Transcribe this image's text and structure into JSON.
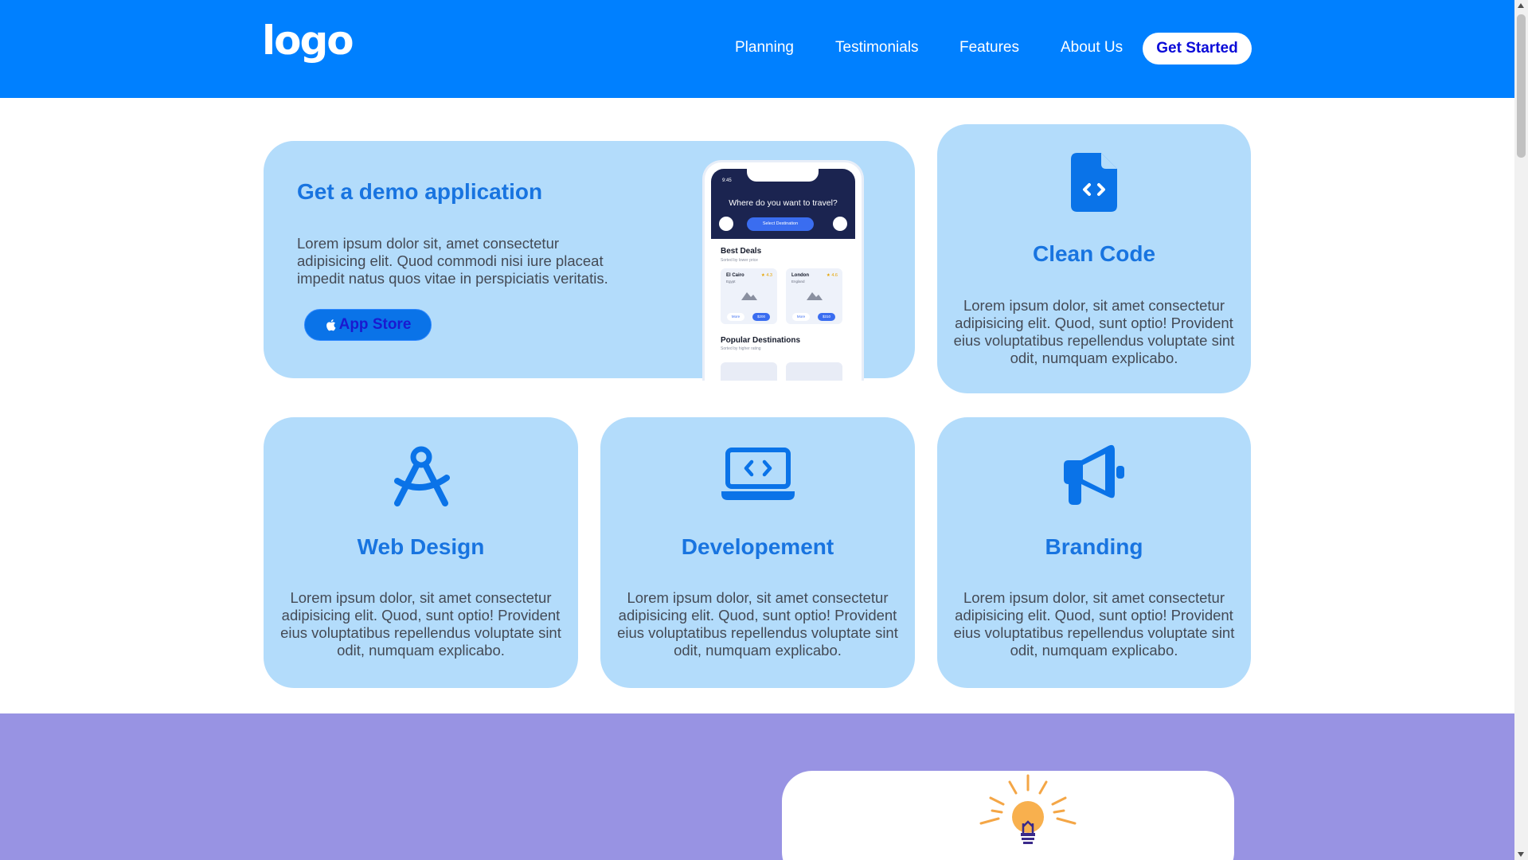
{
  "colors": {
    "header": "#0080ff",
    "card": "#b3dcfb",
    "title": "#1874e0",
    "bottom_section": "#9893e3"
  },
  "header": {
    "logo": "logo",
    "nav": [
      "Planning",
      "Testimonials",
      "Features",
      "About Us"
    ],
    "cta": "Get Started"
  },
  "demo": {
    "title": "Get a demo application",
    "text": "Lorem ipsum dolor sit, amet consectetur adipisicing elit. Quod commodi nisi iure placeat impedit natus quos vitae in perspiciatis veritatis.",
    "store_button": "App Store",
    "store_icon": "apple-icon",
    "phone": {
      "time": "9:45",
      "question": "Where do you want to travel?",
      "select": "Select Destination",
      "best_deals": "Best Deals",
      "best_deals_sub": "Sorted by lower price",
      "deals": [
        {
          "city": "El Cairo",
          "country": "Egypt",
          "rating": "★ 4.3",
          "more": "More",
          "price": "$200"
        },
        {
          "city": "London",
          "country": "England",
          "rating": "★ 4.6",
          "more": "More",
          "price": "$310"
        }
      ],
      "popular": "Popular Destinations",
      "popular_sub": "Sorted by higher rating"
    }
  },
  "services": [
    {
      "icon": "file-code-icon",
      "title": "Clean Code",
      "text": "Lorem ipsum dolor, sit amet consectetur adipisicing elit. Quod, sunt optio! Provident eius voluptatibus repellendus voluptate sint odit, numquam explicabo."
    },
    {
      "icon": "compass-drafting-icon",
      "title": "Web Design",
      "text": "Lorem ipsum dolor, sit amet consectetur adipisicing elit. Quod, sunt optio! Provident eius voluptatibus repellendus voluptate sint odit, numquam explicabo."
    },
    {
      "icon": "laptop-code-icon",
      "title": "Developement",
      "text": "Lorem ipsum dolor, sit amet consectetur adipisicing elit. Quod, sunt optio! Provident eius voluptatibus repellendus voluptate sint odit, numquam explicabo."
    },
    {
      "icon": "megaphone-icon",
      "title": "Branding",
      "text": "Lorem ipsum dolor, sit amet consectetur adipisicing elit. Quod, sunt optio! Provident eius voluptatibus repellendus voluptate sint odit, numquam explicabo."
    }
  ],
  "bottom_section": {
    "icon": "lightbulb-icon"
  }
}
